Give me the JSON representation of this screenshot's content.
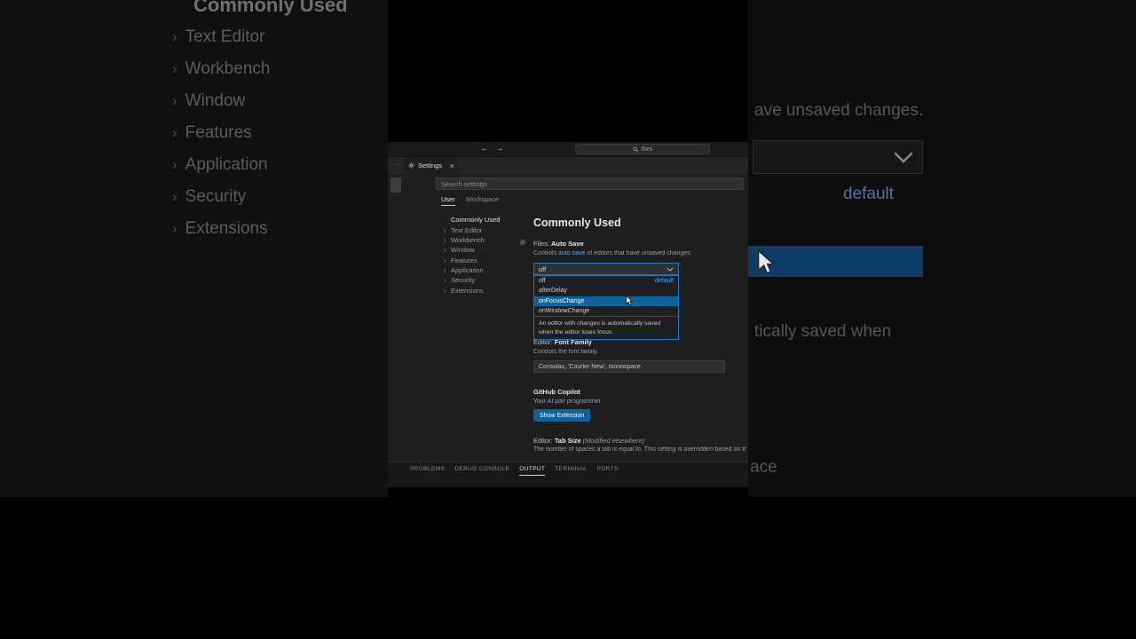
{
  "icons": {
    "chevron_right": "›"
  },
  "background": {
    "left_panel": {
      "header": "Commonly Used",
      "items": [
        "Text Editor",
        "Workbench",
        "Window",
        "Features",
        "Application",
        "Security",
        "Extensions"
      ]
    },
    "right_panel": {
      "unsaved_fragment": "ave unsaved changes.",
      "default_label": "default",
      "saved_fragment": "tically saved when",
      "ace_fragment": "ace"
    }
  },
  "titlebar": {
    "back": "←",
    "forward": "→",
    "command_center": "files"
  },
  "tabs": {
    "more_dots": "···",
    "settings_tab": "Settings",
    "close": "×"
  },
  "settings": {
    "search_placeholder": "Search settings",
    "scopes": [
      "User",
      "Workspace"
    ],
    "toc": [
      "Commonly Used",
      "Text Editor",
      "Workbench",
      "Window",
      "Features",
      "Application",
      "Security",
      "Extensions"
    ],
    "heading": "Commonly Used",
    "auto_save": {
      "label_prefix": "Files: ",
      "label_name": "Auto Save",
      "desc_before": "Controls ",
      "desc_link": "auto save",
      "desc_after": " of editors that have unsaved changes.",
      "value": "off",
      "options": [
        {
          "label": "off",
          "detail": "default"
        },
        {
          "label": "afterDelay",
          "detail": ""
        },
        {
          "label": "onFocusChange",
          "detail": ""
        },
        {
          "label": "onWindowChange",
          "detail": ""
        }
      ],
      "selected_option": "onFocusChange",
      "option_description": "An editor with changes is automatically saved when the editor loses focus."
    },
    "font_family": {
      "label_prefix": "Editor: ",
      "label_name": "Font Family",
      "description": "Controls the font family.",
      "value": "Consolas, 'Courier New', monospace"
    },
    "copilot": {
      "title": "GitHub Copilot",
      "description": "Your AI pair programmer",
      "button": "Show Extension"
    },
    "tab_size": {
      "label_prefix": "Editor: ",
      "label_name": "Tab Size",
      "label_suffix": "(Modified elsewhere)",
      "description": "The number of spaces a tab is equal to. This setting is overridden based on the fil"
    }
  },
  "panel": {
    "tabs": [
      "PROBLEMS",
      "DEBUG CONSOLE",
      "OUTPUT",
      "TERMINAL",
      "PORTS"
    ],
    "active_tab": "OUTPUT"
  },
  "colors": {
    "focus_border": "#0a7acc",
    "link_blue": "#4daafc",
    "selection_blue": "#0e639c",
    "button_blue": "#0e639c"
  }
}
